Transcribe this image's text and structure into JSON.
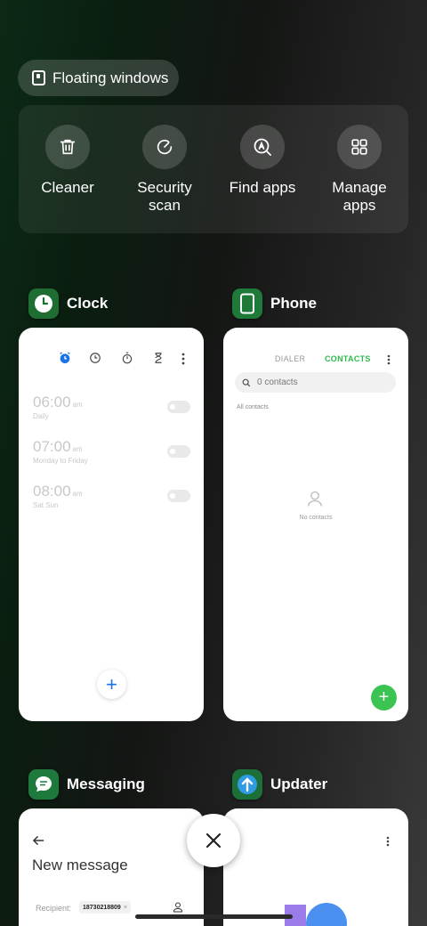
{
  "floating_windows": {
    "label": "Floating windows"
  },
  "tools": [
    {
      "label": "Cleaner",
      "icon": "trash-icon"
    },
    {
      "label": "Security\nscan",
      "icon": "security-scan-icon"
    },
    {
      "label": "Find apps",
      "icon": "find-apps-icon"
    },
    {
      "label": "Manage\napps",
      "icon": "grid-icon"
    }
  ],
  "apps": {
    "clock": {
      "name": "Clock",
      "alarms": [
        {
          "time": "06:00",
          "ampm": "am",
          "repeat": "Daily"
        },
        {
          "time": "07:00",
          "ampm": "am",
          "repeat": "Monday to Friday"
        },
        {
          "time": "08:00",
          "ampm": "am",
          "repeat": "Sat Sun"
        }
      ],
      "fab": "+"
    },
    "phone": {
      "name": "Phone",
      "tabs": {
        "dialer": "DIALER",
        "contacts": "CONTACTS"
      },
      "search_placeholder": "0 contacts",
      "filter": "All contacts",
      "empty": "No contacts",
      "fab": "+"
    },
    "messaging": {
      "name": "Messaging",
      "title": "New message",
      "recipient_label": "Recipient:",
      "recipient_chip": "18730218809",
      "chip_close": "×"
    },
    "updater": {
      "name": "Updater"
    }
  },
  "colors": {
    "accent_blue": "#1a73e8",
    "contacts_green": "#2dba4e",
    "fab_green": "#3cc452"
  }
}
